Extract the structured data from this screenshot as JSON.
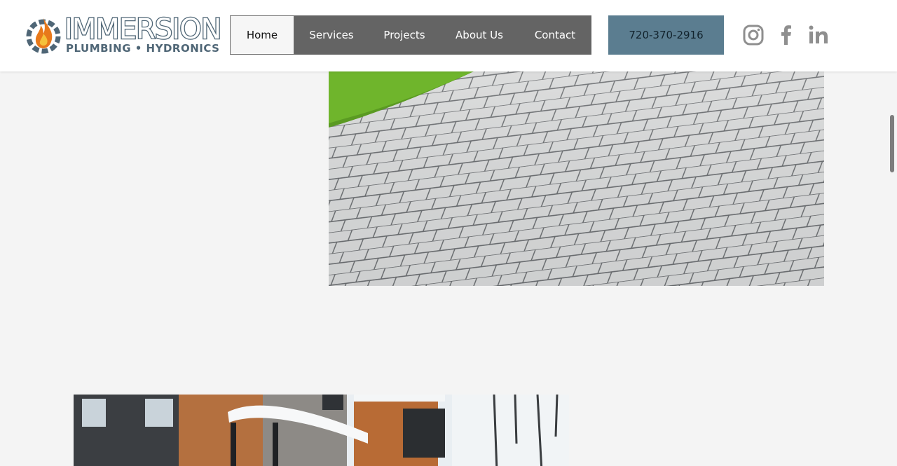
{
  "brand": {
    "name_line1": "IMMERSION",
    "name_line2": "PLUMBING • HYDRONICS",
    "colors": {
      "logo_slate": "#4f6676",
      "flame_orange": "#e8791a",
      "flame_yellow": "#f5c13a"
    }
  },
  "nav": {
    "items": [
      {
        "label": "Home",
        "active": true
      },
      {
        "label": "Services",
        "active": false
      },
      {
        "label": "Projects",
        "active": false
      },
      {
        "label": "About Us",
        "active": false
      },
      {
        "label": "Contact",
        "active": false
      }
    ],
    "colors": {
      "bar": "#646464",
      "active_bg": "#f6f6f6"
    }
  },
  "phone": {
    "label": "720-370-2916",
    "color": "#5b7d90"
  },
  "social": [
    {
      "icon": "instagram-icon"
    },
    {
      "icon": "facebook-icon"
    },
    {
      "icon": "linkedin-icon"
    }
  ],
  "images": [
    {
      "icon": "paver-driveway-photo"
    },
    {
      "icon": "modern-house-snow-photo"
    }
  ]
}
